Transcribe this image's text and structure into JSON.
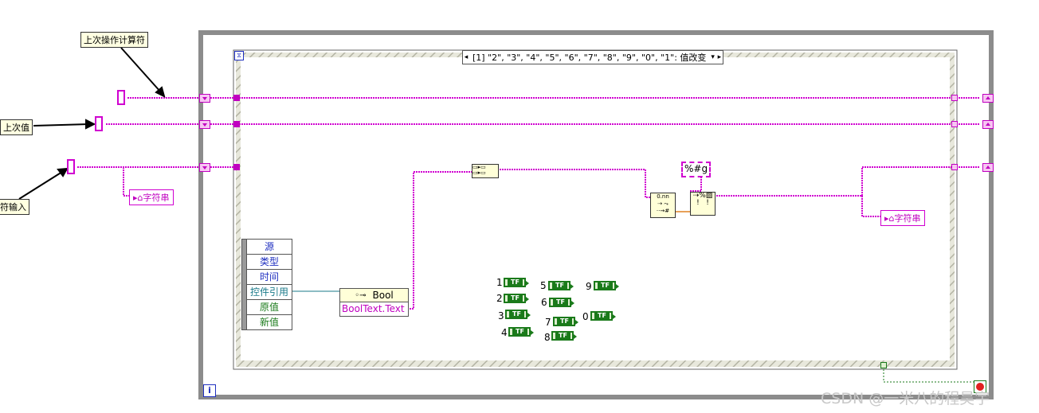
{
  "selector_label": "[1] \"2\", \"3\", \"4\", \"5\", \"6\", \"7\", \"8\", \"9\", \"0\", \"1\": 值改变",
  "notes": {
    "last_operator": "上次操作计算符",
    "last_value": "上次值",
    "input": "符输入"
  },
  "string_indicators": [
    "字符串",
    "字符串"
  ],
  "event_data": [
    "源",
    "类型",
    "时间",
    "控件引用",
    "原值",
    "新值"
  ],
  "property_node": {
    "class": "Bool",
    "property": "BoolText.Text"
  },
  "format_string": "%#g",
  "bool_buttons": [
    {
      "label": "1",
      "text": "TF"
    },
    {
      "label": "2",
      "text": "TF"
    },
    {
      "label": "3",
      "text": "TF"
    },
    {
      "label": "4",
      "text": "TF"
    },
    {
      "label": "5",
      "text": "TF"
    },
    {
      "label": "6",
      "text": "TF"
    },
    {
      "label": "7",
      "text": "TF"
    },
    {
      "label": "8",
      "text": "TF"
    },
    {
      "label": "9",
      "text": "TF"
    },
    {
      "label": "0",
      "text": "TF"
    }
  ],
  "loop_iteration": "i",
  "watermark": "CSDN @一米八的程昊宇",
  "colors": {
    "string_wire": "#d000d0",
    "bool": "#1a7a1a",
    "loop_border": "#8c8c8c",
    "case_hatch": "#c8c8b8"
  }
}
